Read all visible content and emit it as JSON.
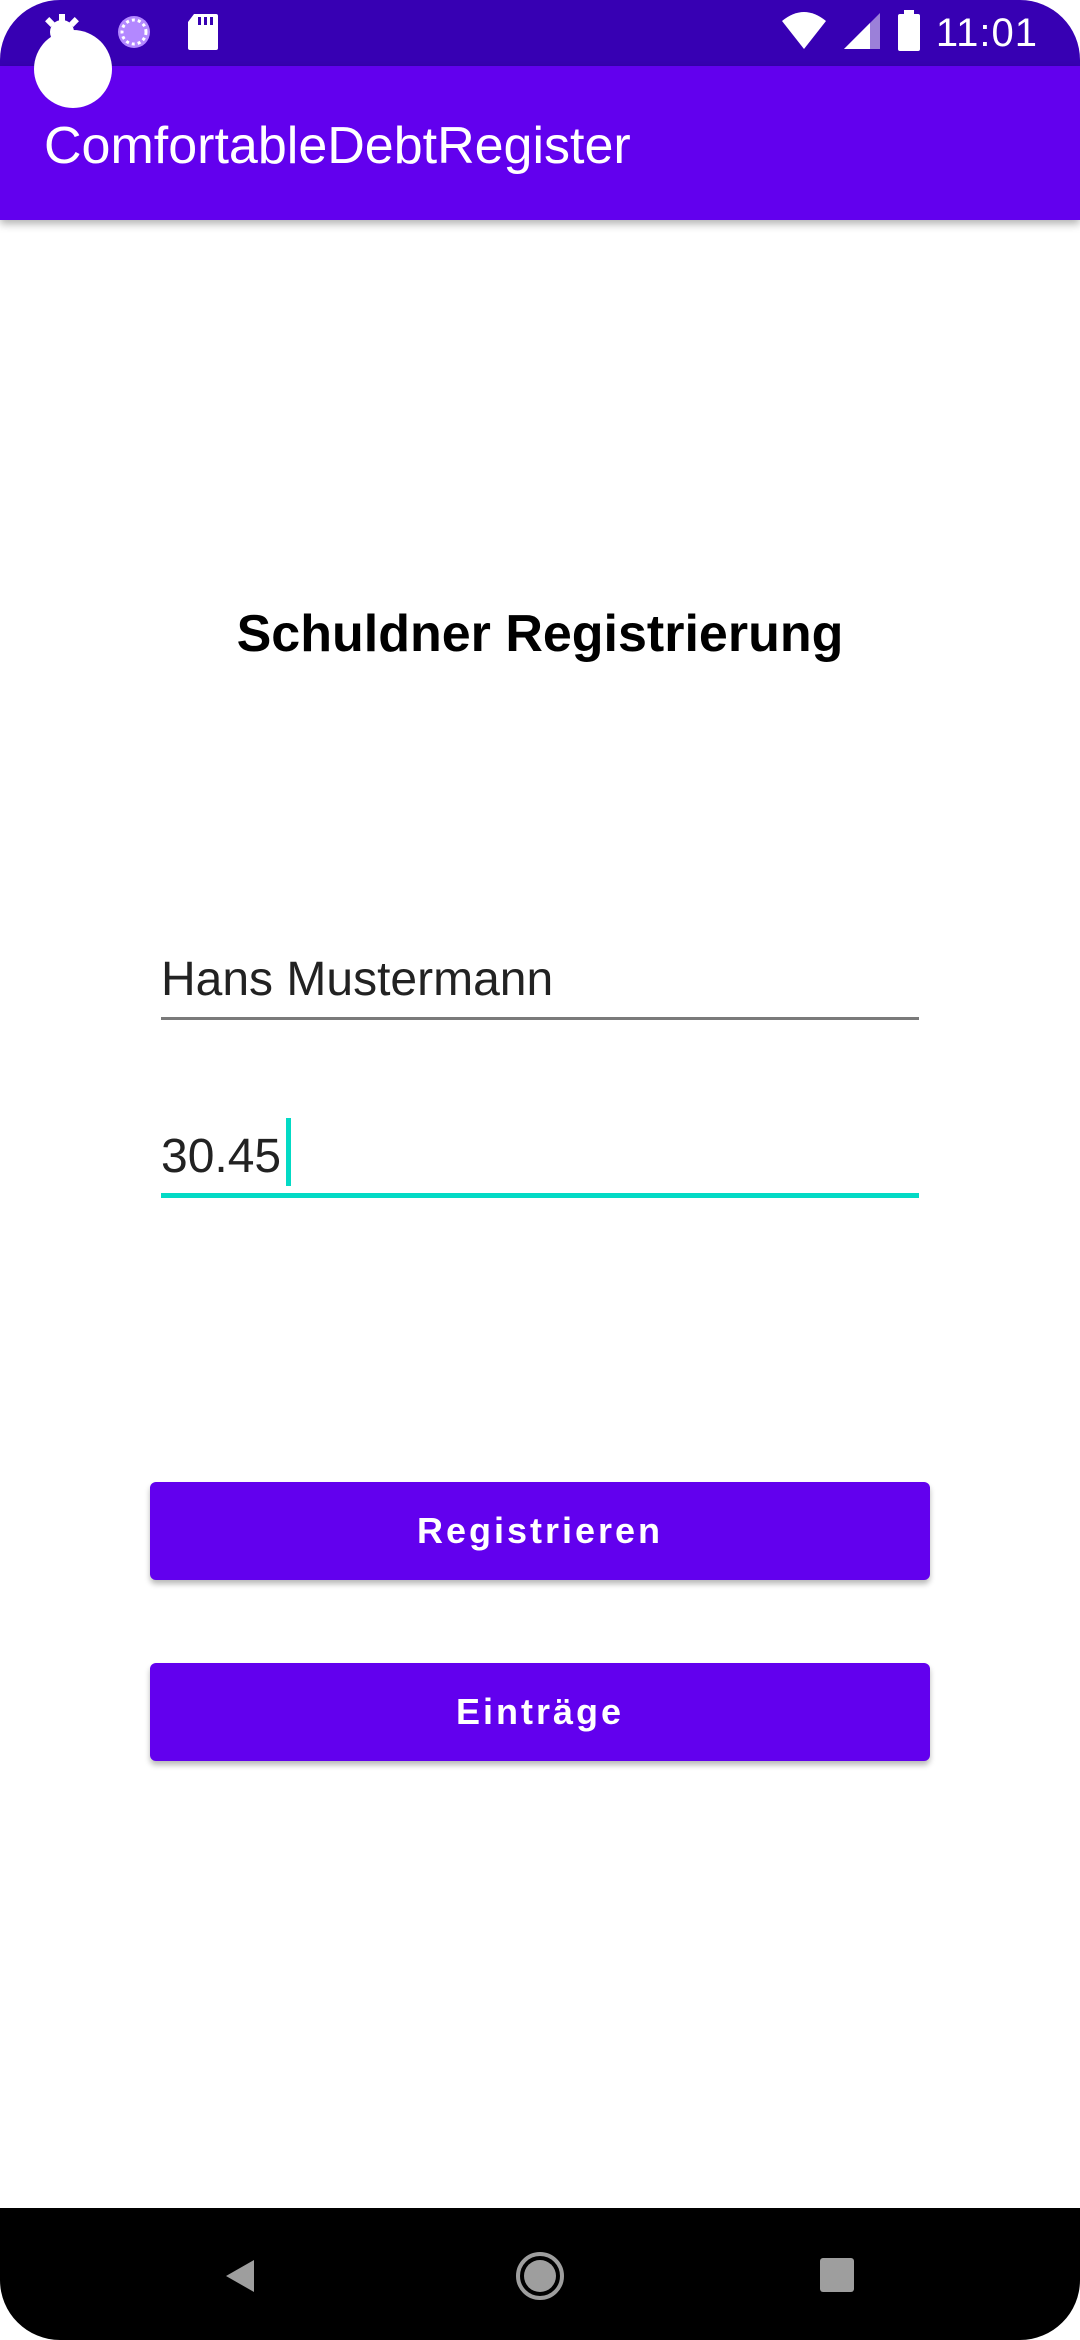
{
  "status_bar": {
    "time": "11:01",
    "left_icons": [
      "settings-icon",
      "loading-spinner-icon",
      "sd-card-icon"
    ],
    "right_icons": [
      "wifi-icon",
      "cell-signal-icon",
      "battery-icon"
    ],
    "background": "#3700b3"
  },
  "app_bar": {
    "title": "ComfortableDebtRegister",
    "background": "#6200ee"
  },
  "form": {
    "heading": "Schuldner Registrierung",
    "name_value": "Hans Mustermann",
    "amount_value": "30.45",
    "focus_color": "#03dac5"
  },
  "buttons": {
    "register_label": "Registrieren",
    "entries_label": "Einträge",
    "color": "#6200ee"
  },
  "nav_bar": {
    "icons": [
      "back-icon",
      "home-icon",
      "recents-icon"
    ]
  }
}
